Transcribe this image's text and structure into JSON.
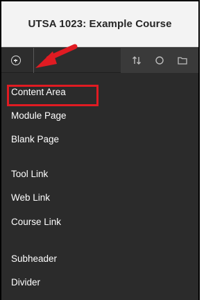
{
  "header": {
    "title": "UTSA 1023: Example Course"
  },
  "toolbar": {
    "add_icon": "add-circle-icon",
    "reorder_icon": "reorder-arrows-icon",
    "refresh_icon": "refresh-icon",
    "folder_icon": "folder-icon"
  },
  "menu": {
    "items": [
      {
        "label": "Content Area"
      },
      {
        "label": "Module Page"
      },
      {
        "label": "Blank Page"
      },
      {
        "label": "Tool Link"
      },
      {
        "label": "Web Link"
      },
      {
        "label": "Course Link"
      },
      {
        "label": "Subheader"
      },
      {
        "label": "Divider"
      }
    ]
  },
  "colors": {
    "menu_bg": "#2b2b2b",
    "header_bg": "#f3f3f3",
    "highlight_red": "#e01b22"
  }
}
